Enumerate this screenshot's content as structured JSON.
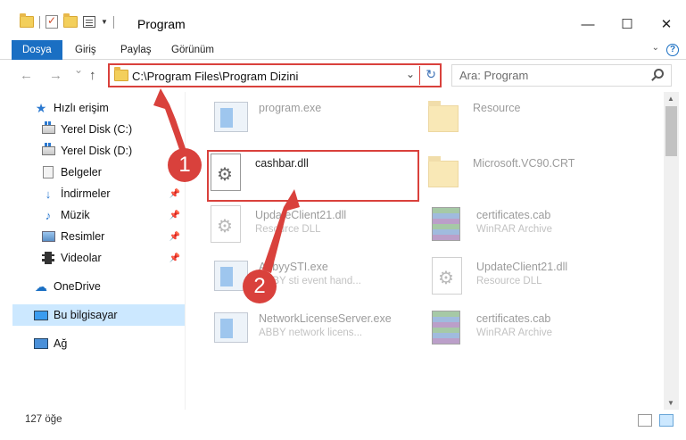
{
  "window": {
    "title": "Program",
    "minimize": "—",
    "maximize": "☐",
    "close": "✕"
  },
  "ribbon": {
    "tabs": [
      "Dosya",
      "Giriş",
      "Paylaş",
      "Görünüm"
    ],
    "help": "?"
  },
  "nav": {
    "back": "←",
    "forward": "→",
    "recent": "⌄",
    "up": "↑",
    "address": "C:\\Program Files\\Program Dizini",
    "search_placeholder": "Ara: Program"
  },
  "sidebar": {
    "items": [
      {
        "label": "Hızlı erişim",
        "icon": "star-icon"
      },
      {
        "label": "Yerel Disk (C:)",
        "icon": "drive-icon"
      },
      {
        "label": "Yerel Disk (D:)",
        "icon": "drive-icon"
      },
      {
        "label": "Belgeler",
        "icon": "documents-icon"
      },
      {
        "label": "İndirmeler",
        "icon": "downloads-icon"
      },
      {
        "label": "Müzik",
        "icon": "music-icon"
      },
      {
        "label": "Resimler",
        "icon": "pictures-icon"
      },
      {
        "label": "Videolar",
        "icon": "videos-icon"
      },
      {
        "label": "OneDrive",
        "icon": "cloud-icon"
      },
      {
        "label": "Bu bilgisayar",
        "icon": "computer-icon"
      },
      {
        "label": "Ağ",
        "icon": "network-icon"
      }
    ]
  },
  "files": [
    {
      "name": "program.exe",
      "desc": ""
    },
    {
      "name": "Resource",
      "desc": ""
    },
    {
      "name": "cashbar.dll",
      "desc": ""
    },
    {
      "name": "Microsoft.VC90.CRT",
      "desc": ""
    },
    {
      "name": "UpdateClient21.dll",
      "desc": "Resource DLL"
    },
    {
      "name": "certificates.cab",
      "desc": "WinRAR Archive"
    },
    {
      "name": "AbbyySTI.exe",
      "desc": "ABBY sti event hand..."
    },
    {
      "name": "UpdateClient21.dll",
      "desc": "Resource DLL"
    },
    {
      "name": "NetworkLicenseServer.exe",
      "desc": "ABBY network licens..."
    },
    {
      "name": "certificates.cab",
      "desc": "WinRAR Archive"
    }
  ],
  "status": {
    "count": "127 öğe"
  },
  "annotations": {
    "step1": "1",
    "step2": "2",
    "accent": "#d9413c"
  }
}
